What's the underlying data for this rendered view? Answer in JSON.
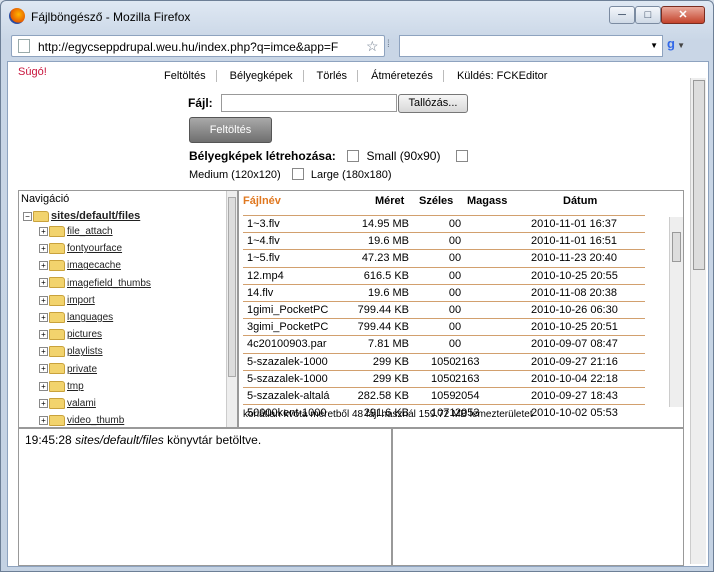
{
  "window": {
    "title": "Fájlböngésző - Mozilla Firefox",
    "min": "─",
    "max": "□",
    "close": "✕"
  },
  "nav": {
    "url": "http://egycseppdrupal.weu.hu/index.php?q=imce&app=F",
    "google": "g"
  },
  "toolbar": {
    "help": "Súgó!",
    "tabs": [
      "Feltöltés",
      "Bélyegképek",
      "Törlés",
      "Átméretezés",
      "Küldés: FCKEditor"
    ]
  },
  "upload": {
    "file_label": "Fájl:",
    "browse": "Tallózás...",
    "submit": "Feltöltés",
    "thumbs_label": "Bélyegképek létrehozása:",
    "small": "Small (90x90)",
    "medium": "Medium (120x120)",
    "large": "Large (180x180)"
  },
  "navigation": {
    "title": "Navigáció",
    "root": "sites/default/files",
    "children": [
      "file_attach",
      "fontyourface",
      "imagecache",
      "imagefield_thumbs",
      "import",
      "languages",
      "pictures",
      "playlists",
      "private",
      "tmp",
      "valami",
      "video_thumb"
    ]
  },
  "files": {
    "columns": [
      "Fájlnév",
      "Méret",
      "Széles",
      "Magass",
      "Dátum"
    ],
    "rows": [
      [
        "1~3.flv",
        "14.95 MB",
        "0",
        "0",
        "2010-11-01 16:37"
      ],
      [
        "1~4.flv",
        "19.6 MB",
        "0",
        "0",
        "2010-11-01 16:51"
      ],
      [
        "1~5.flv",
        "47.23 MB",
        "0",
        "0",
        "2010-11-23 20:40"
      ],
      [
        "12.mp4",
        "616.5 KB",
        "0",
        "0",
        "2010-10-25 20:55"
      ],
      [
        "14.flv",
        "19.6 MB",
        "0",
        "0",
        "2010-11-08 20:38"
      ],
      [
        "1gimi_PocketPC",
        "799.44 KB",
        "0",
        "0",
        "2010-10-26 06:30"
      ],
      [
        "3gimi_PocketPC",
        "799.44 KB",
        "0",
        "0",
        "2010-10-25 20:51"
      ],
      [
        "4c20100903.par",
        "7.81 MB",
        "0",
        "0",
        "2010-09-07 08:47"
      ],
      [
        "5-szazalek-1000",
        "299 KB",
        "1050",
        "2163",
        "2010-09-27 21:16"
      ],
      [
        "5-szazalek-1000",
        "299 KB",
        "1050",
        "2163",
        "2010-10-04 22:18"
      ],
      [
        "5-szazalek-altalá",
        "282.58 KB",
        "1059",
        "2054",
        "2010-09-27 18:43"
      ],
      [
        "50000kent-1000",
        "291.6 KB",
        "1071",
        "2053",
        "2010-10-02 05:53"
      ]
    ],
    "status": "korlátlan kvóta méretből 48 fájl használ 159.72 MB lemezterületet"
  },
  "log": {
    "time": "19:45:28",
    "path": "sites/default/files",
    "msg": " könyvtár betöltve."
  }
}
